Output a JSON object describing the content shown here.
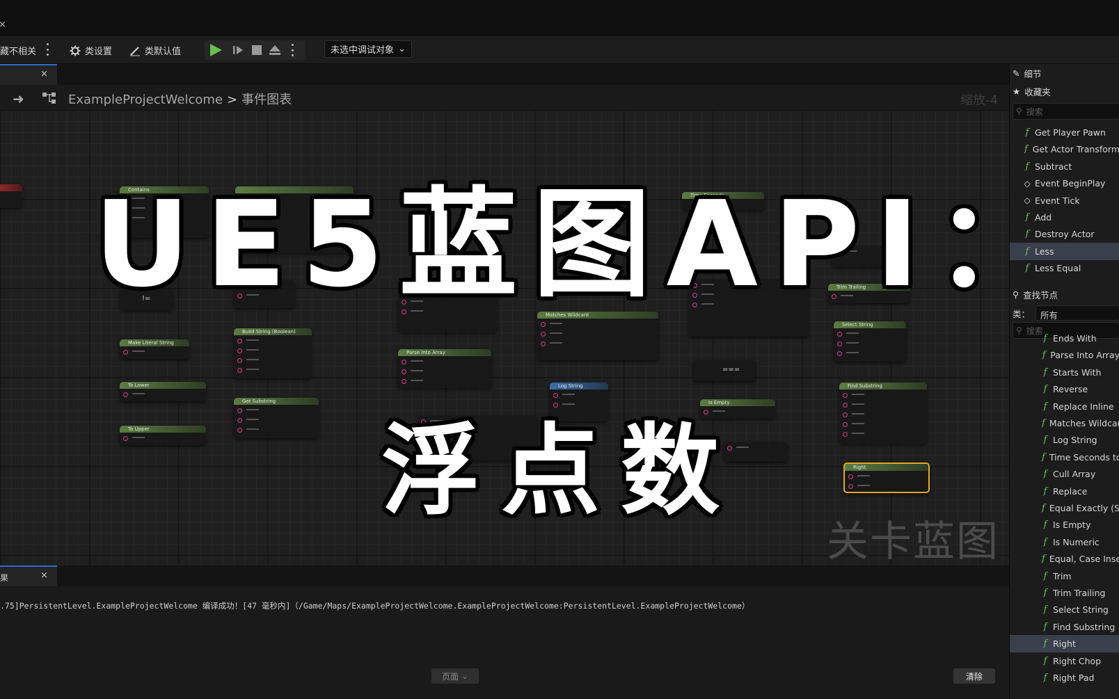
{
  "toolbar": {
    "hide_unrelated": "藏不相关",
    "class_settings": "类设置",
    "class_defaults": "类默认值",
    "debug_target": "未选中调试对象"
  },
  "graph_tab": {
    "label": ""
  },
  "breadcrumb": {
    "project": "ExampleProjectWelcome",
    "graph": "事件图表",
    "zoom": "缩放-4"
  },
  "overlay": {
    "title": "UE5蓝图API：",
    "subtitle": "浮点数"
  },
  "watermark": "关卡蓝图",
  "graph_nodes": [
    "Contains",
    "Time Seconds",
    "Build String (Boolean)",
    "Make Literal String",
    "To Lower",
    "To Upper",
    "Get Substring",
    "Parse Into Array",
    "Matches Wildcard",
    "Log String",
    "Is Empty",
    "Select String",
    "Find Substring",
    "Right",
    "Trim Trailing",
    "Return Value",
    "Source String",
    "Search Case",
    "添加引脚",
    "Append To",
    "Prefix",
    "In Bool",
    "Suffix",
    "Value",
    "Start Index",
    "Length",
    "Delimiter",
    "Cull Empty Strings",
    "Wildcard",
    "In String",
    "Pick A",
    "Use Case",
    "Search from End",
    "Start Position",
    "Count",
    "From",
    "To",
    "Search In",
    "Substring",
    "Hello",
    "In Seconds",
    "A",
    "B"
  ],
  "ops": {
    "neq": "!=",
    "eq": "==="
  },
  "results": {
    "tab": "果",
    "log": ".75]PersistentLevel.ExampleProjectWelcome 编译成功！[47 毫秒内]（/Game/Maps/ExampleProjectWelcome.ExampleProjectWelcome:PersistentLevel.ExampleProjectWelcome）",
    "page": "页面",
    "clear": "清除"
  },
  "right_panel": {
    "details": "细节",
    "favorites": "收藏夹",
    "search_placeholder": "搜索",
    "favorites_items": [
      {
        "label": "Get Player Pawn",
        "kind": "fn"
      },
      {
        "label": "Get Actor Transform",
        "kind": "fn"
      },
      {
        "label": "Subtract",
        "kind": "fn"
      },
      {
        "label": "Event BeginPlay",
        "kind": "event"
      },
      {
        "label": "Event Tick",
        "kind": "event"
      },
      {
        "label": "Add",
        "kind": "fn"
      },
      {
        "label": "Destroy Actor",
        "kind": "fn"
      },
      {
        "label": "Less",
        "kind": "fn",
        "selected": true
      },
      {
        "label": "Less Equal",
        "kind": "fn"
      }
    ],
    "find_nodes": "查找节点",
    "category_label": "类：",
    "category_value": "所有",
    "node_items": [
      {
        "label": "Ends With"
      },
      {
        "label": "Parse Into Array"
      },
      {
        "label": "Starts With"
      },
      {
        "label": "Reverse"
      },
      {
        "label": "Replace Inline"
      },
      {
        "label": "Matches Wildcard"
      },
      {
        "label": "Log String"
      },
      {
        "label": "Time Seconds to"
      },
      {
        "label": "Cull Array"
      },
      {
        "label": "Replace"
      },
      {
        "label": "Equal Exactly (S"
      },
      {
        "label": "Is Empty"
      },
      {
        "label": "Is Numeric"
      },
      {
        "label": "Equal, Case Inse"
      },
      {
        "label": "Trim"
      },
      {
        "label": "Trim Trailing"
      },
      {
        "label": "Select String"
      },
      {
        "label": "Find Substring"
      },
      {
        "label": "Right",
        "selected": true
      },
      {
        "label": "Right Chop"
      },
      {
        "label": "Right Pad"
      }
    ]
  },
  "colors": {
    "accent": "#2b6bd6",
    "play": "#65c04a",
    "function_icon": "#6fc25a",
    "selected_node": "#e6a91f"
  }
}
